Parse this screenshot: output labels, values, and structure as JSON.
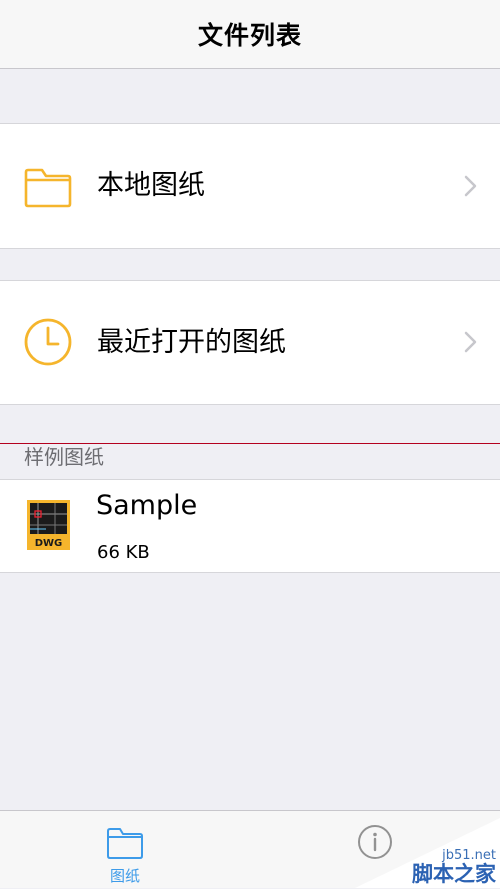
{
  "nav": {
    "title": "文件列表"
  },
  "rows": {
    "local": {
      "label": "本地图纸",
      "icon": "folder-icon"
    },
    "recent": {
      "label": "最近打开的图纸",
      "icon": "clock-icon"
    }
  },
  "sample_section": {
    "header": "样例图纸",
    "file": {
      "name": "Sample",
      "size": "66 KB",
      "badge": "DWG",
      "icon": "dwg-file-icon"
    }
  },
  "tab_bar": {
    "tabs": [
      {
        "label": "图纸",
        "icon": "folder-tab-icon",
        "selected": true
      },
      {
        "label": "",
        "icon": "info-icon",
        "selected": false
      }
    ]
  },
  "watermark": {
    "line1": "jb51.net",
    "line2": "脚本之家"
  },
  "colors": {
    "accent_orange": "#f5b52c",
    "accent_blue": "#3d9be9",
    "background": "#efeff4"
  }
}
